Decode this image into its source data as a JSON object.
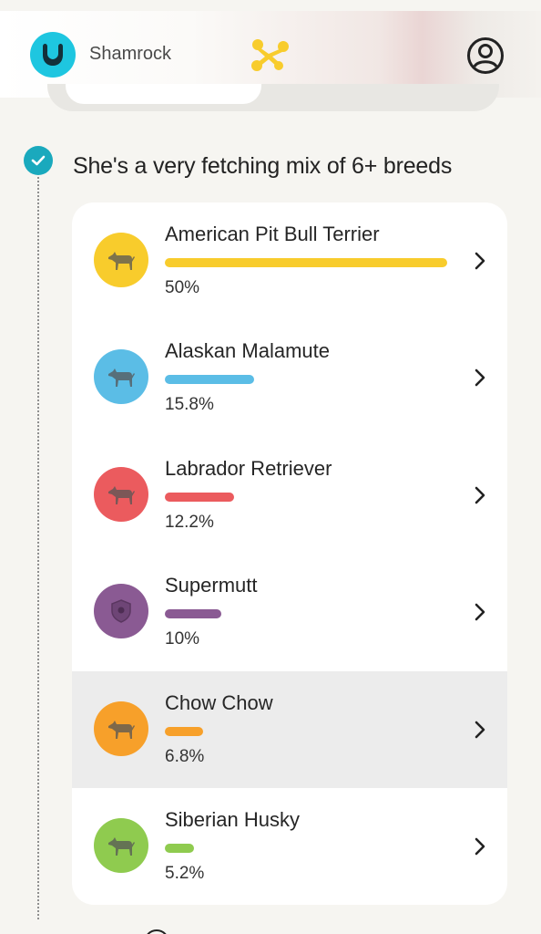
{
  "header": {
    "pet_name": "Shamrock",
    "logo_icon": "paw-logo-icon",
    "toy_icon": "bone-toy-icon",
    "account_icon": "account-icon",
    "logo_color": "#1ec6e0",
    "toy_color": "#f8cc2c"
  },
  "section": {
    "title": "She's a very fetching mix of 6+ breeds",
    "check_color": "#1aa9bd"
  },
  "breeds": [
    {
      "name": "American Pit Bull Terrier",
      "percent_label": "50%",
      "percent": 50,
      "color": "#f8cc2c",
      "icon": "dog-silhouette-icon"
    },
    {
      "name": "Alaskan Malamute",
      "percent_label": "15.8%",
      "percent": 15.8,
      "color": "#5bbde6",
      "icon": "dog-silhouette-icon"
    },
    {
      "name": "Labrador Retriever",
      "percent_label": "12.2%",
      "percent": 12.2,
      "color": "#eb5b5e",
      "icon": "dog-silhouette-icon"
    },
    {
      "name": "Supermutt",
      "percent_label": "10%",
      "percent": 10,
      "color": "#8a5a93",
      "icon": "supermutt-badge-icon"
    },
    {
      "name": "Chow Chow",
      "percent_label": "6.8%",
      "percent": 6.8,
      "color": "#f7a02a",
      "icon": "dog-silhouette-icon"
    },
    {
      "name": "Siberian Husky",
      "percent_label": "5.2%",
      "percent": 5.2,
      "color": "#8fcb4f",
      "icon": "dog-silhouette-icon"
    }
  ]
}
